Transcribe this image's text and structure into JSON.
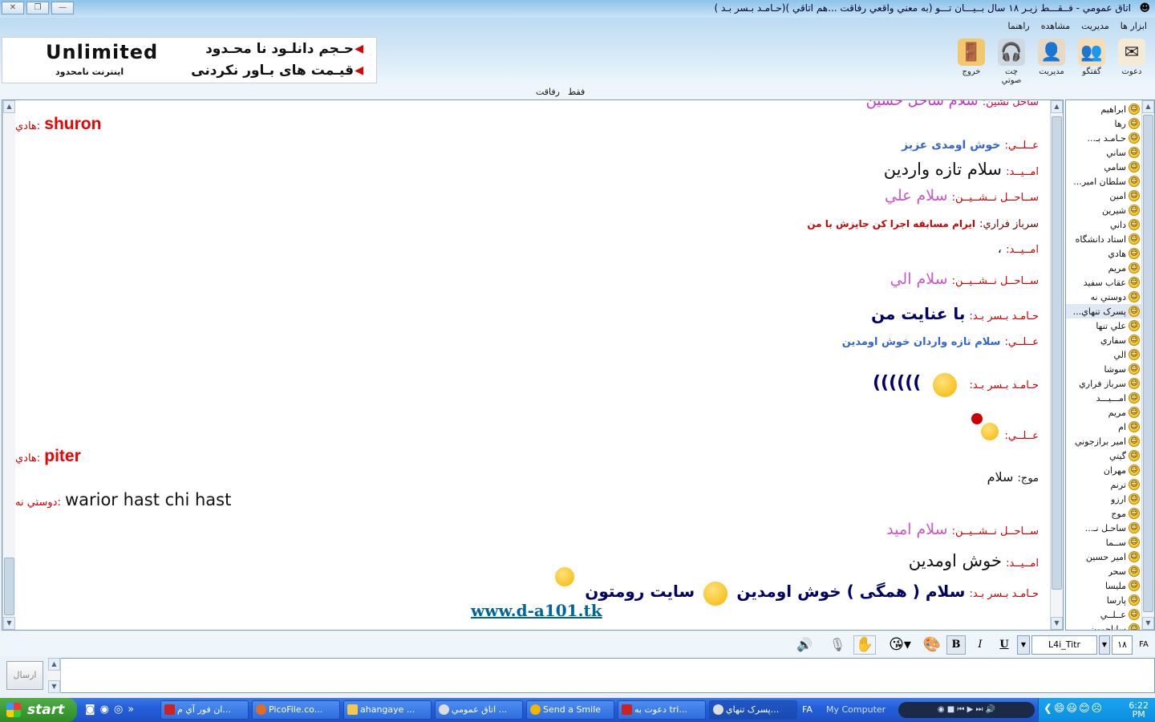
{
  "window": {
    "title": "اتاق عمومي - فــقـــط زيـر ۱۸ سال بــيـــان تـــو (به معني واقعي رفاقت ...هم اتاقي )(حـامـد بـسر بـد )",
    "btn_close": "✕",
    "btn_restore": "❐",
    "btn_min": "—"
  },
  "menu": [
    "ابزار ها",
    "مديريت",
    "مشاهده",
    "راهنما"
  ],
  "toolbar": [
    {
      "label": "دعوت",
      "icon": "invite-icon"
    },
    {
      "label": "گفتگو",
      "icon": "chat-people-icon"
    },
    {
      "label": "مديريت",
      "icon": "admin-icon"
    },
    {
      "label": "چت صوتي",
      "icon": "voice-chat-icon"
    },
    {
      "label": "خروج",
      "icon": "exit-door-icon"
    }
  ],
  "banner": {
    "title": "Unlimited",
    "subtitle": "اينترنت نامحدود",
    "line1": "حـجم دانلـود نا محـدود",
    "line2": "قيـمت هاى بـاور نكردنى"
  },
  "subnav": {
    "left": "رفاقت",
    "right": "فقط"
  },
  "messages": {
    "m0_nick": "ساحل نشين:",
    "m0_text": "سلام ساحل حسين",
    "m1_nick": "هادي:",
    "m1_text": "shuron",
    "m2_nick": "عــلــي:",
    "m2_text": "خوش اومدی عزيز",
    "m3_nick": "امــيــد:",
    "m3_text": "سلام تازه واردين",
    "m4_nick": "ســاحــل نــشــيــن:",
    "m4_text": "سلام علي",
    "m5_nick": "سرباز فراري:",
    "m5_text": "ايرام مسابقه اجرا کن جايزش با من",
    "m6_nick": "امــيــد:",
    "m6_text": "،",
    "m7_nick": "ســاحــل نــشــيــن:",
    "m7_text": "سلام الي",
    "m8_nick": "حـامـد بـسر بـد:",
    "m8_text": "با عنايت من",
    "m9_nick": "عــلــي:",
    "m9_text": "سلام تازه واردان خوش اومدين",
    "m10_nick": "حـامـد بـسر بـد:",
    "m10_text": "))))))",
    "m11_nick": "عــلــي:",
    "m12_nick": "هادي:",
    "m12_text": "piter",
    "m13_nick": "موج:",
    "m13_text": "سلام",
    "m14_nick": "دوستي نه:",
    "m14_text": "warior hast chi hast",
    "m15_nick": "ســاحــل نــشــيــن:",
    "m15_text": "سلام اميد",
    "m16_nick": "امــيــد:",
    "m16_text": "خوش اومدين",
    "m17_nick": "حـامـد بـسر بـد:",
    "m17_text1": "سلام ( همگی ) خوش اومدين",
    "m17_text2": "سايت رومتون",
    "m17_link": "www.d-a101.tk"
  },
  "users": [
    "ابراهيم",
    "رها",
    "حـامـد بـ...",
    "ساني",
    "سامي",
    "سلطان امير...",
    "امين",
    "شيرين",
    "داني",
    "استاد دانشگاه",
    "هادي",
    "مريم",
    "عقاب سفيد",
    "دوستي نه",
    "پسرک تنهاي...",
    "علي تنها",
    "سفاري",
    "الي",
    "سوشا",
    "سرباز فراري",
    "امـــيـــد",
    "مريم",
    "ام",
    "امير برازجوني",
    "گيتي",
    "مهران",
    "ترنم",
    "ارزو",
    "موج",
    "ساحـل نـ...",
    "ســما",
    "امير حسين",
    "سحر",
    "مليسا",
    "پارسا",
    "عــلــي",
    "ساناجوون"
  ],
  "format": {
    "lang": "FA",
    "size": "۱۸",
    "font": "L4i_Titr",
    "bold": "B",
    "italic": "I",
    "underline": "U"
  },
  "send_label": "ارسال",
  "taskbar": {
    "start": "start",
    "items": [
      "ان فور آي م...",
      "PicoFile.co...",
      "ahangaye ...",
      "اتاق عمومي ...",
      "Send a Smile",
      "دعوت به tri...",
      "پسرک تنهاي..."
    ],
    "lang": "FA",
    "mycomputer": "My Computer",
    "clock_time": "6:22",
    "clock_ampm": "PM"
  }
}
